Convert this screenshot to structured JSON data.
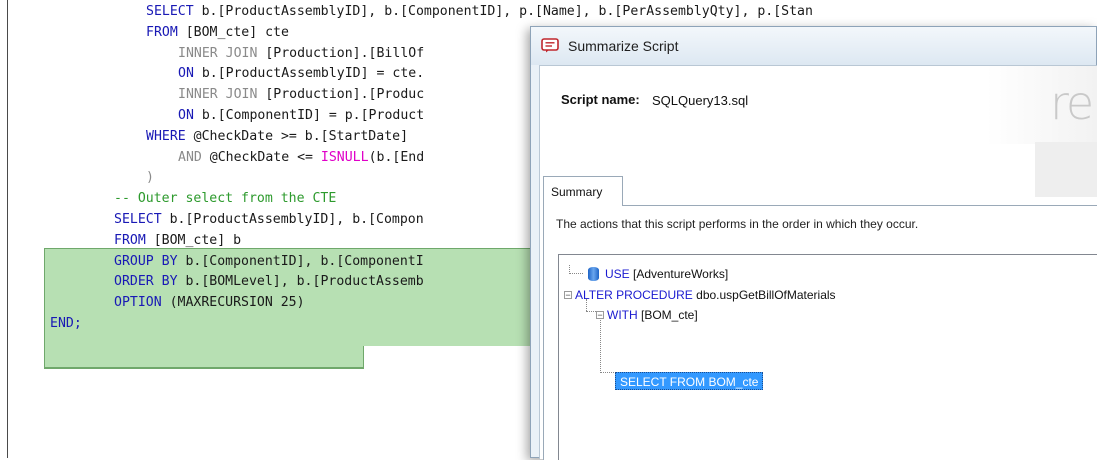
{
  "editor": {
    "lines": [
      {
        "indent": 12,
        "segments": [
          {
            "t": "SELECT ",
            "c": "kw"
          },
          {
            "t": "b.[ProductAssemblyID], b.[ComponentID], p.[Name], b.[PerAssemblyQty], p.[Stan",
            "c": ""
          }
        ]
      },
      {
        "indent": 12,
        "segments": [
          {
            "t": "FROM ",
            "c": "kw"
          },
          {
            "t": "[BOM_cte] cte",
            "c": ""
          }
        ]
      },
      {
        "indent": 16,
        "segments": [
          {
            "t": "INNER JOIN ",
            "c": "gr"
          },
          {
            "t": "[Production].[BillOf",
            "c": ""
          }
        ]
      },
      {
        "indent": 16,
        "segments": [
          {
            "t": "ON ",
            "c": "kw"
          },
          {
            "t": "b.[ProductAssemblyID] = cte.",
            "c": ""
          }
        ]
      },
      {
        "indent": 16,
        "segments": [
          {
            "t": "INNER JOIN ",
            "c": "gr"
          },
          {
            "t": "[Production].[Produc",
            "c": ""
          }
        ]
      },
      {
        "indent": 16,
        "segments": [
          {
            "t": "ON ",
            "c": "kw"
          },
          {
            "t": "b.[ComponentID] = p.[Product",
            "c": ""
          }
        ]
      },
      {
        "indent": 12,
        "segments": [
          {
            "t": "WHERE ",
            "c": "kw"
          },
          {
            "t": "@CheckDate >= b.[StartDate]",
            "c": ""
          }
        ]
      },
      {
        "indent": 16,
        "segments": [
          {
            "t": "AND ",
            "c": "gr"
          },
          {
            "t": "@CheckDate <= ",
            "c": ""
          },
          {
            "t": "ISNULL",
            "c": "fn"
          },
          {
            "t": "(b.[End",
            "c": ""
          }
        ]
      },
      {
        "indent": 12,
        "segments": [
          {
            "t": ")",
            "c": "gr"
          }
        ]
      },
      {
        "indent": 8,
        "segments": [
          {
            "t": "-- Outer select from the CTE",
            "c": "cm"
          }
        ]
      },
      {
        "indent": 8,
        "segments": [
          {
            "t": "SELECT ",
            "c": "kw"
          },
          {
            "t": "b.[ProductAssemblyID], b.[Compon",
            "c": ""
          }
        ]
      },
      {
        "indent": 8,
        "segments": [
          {
            "t": "FROM ",
            "c": "kw"
          },
          {
            "t": "[BOM_cte] b",
            "c": ""
          }
        ]
      },
      {
        "indent": 8,
        "segments": [
          {
            "t": "GROUP BY ",
            "c": "kw"
          },
          {
            "t": "b.[ComponentID], b.[ComponentI",
            "c": ""
          }
        ]
      },
      {
        "indent": 8,
        "segments": [
          {
            "t": "ORDER BY ",
            "c": "kw"
          },
          {
            "t": "b.[BOMLevel], b.[ProductAssemb",
            "c": ""
          }
        ]
      },
      {
        "indent": 8,
        "segments": [
          {
            "t": "OPTION ",
            "c": "kw"
          },
          {
            "t": "(MAXRECURSION 25)",
            "c": ""
          }
        ]
      },
      {
        "indent": 0,
        "segments": [
          {
            "t": "END;",
            "c": "kw"
          }
        ]
      }
    ]
  },
  "dialog": {
    "title": "Summarize Script",
    "script_name_label": "Script name:",
    "script_name_value": "SQLQuery13.sql",
    "logo_fragment": "re",
    "tab_label": "Summary",
    "description": "The actions that this script performs in the order in which they occur.",
    "tree": {
      "use": {
        "keyword": "USE",
        "text": "[AdventureWorks]"
      },
      "alter": {
        "keyword": "ALTER PROCEDURE",
        "text": "dbo.uspGetBillOfMaterials"
      },
      "with": {
        "keyword": "WITH",
        "text": "[BOM_cte]"
      },
      "select_node": "SELECT FROM  BOM_cte"
    },
    "colors": {
      "keyword": "#1a1ad0",
      "selection": "#3399ff",
      "code_highlight": "#b7e0b3"
    }
  }
}
